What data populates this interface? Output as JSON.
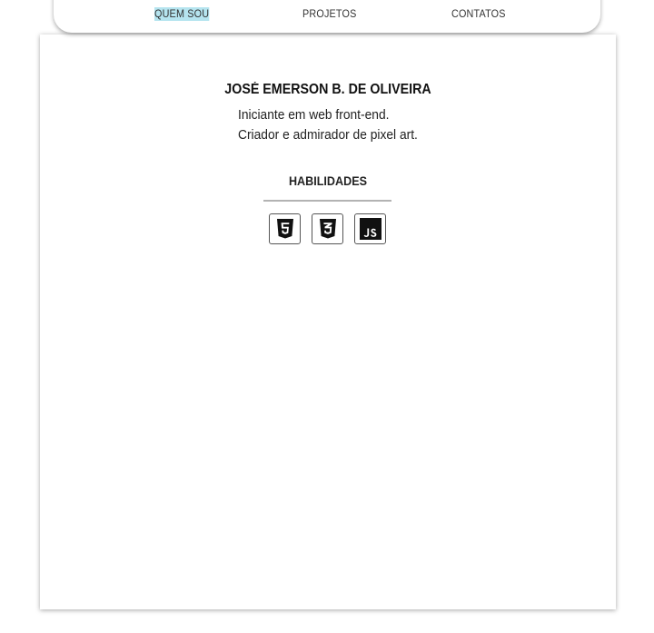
{
  "nav": {
    "items": [
      {
        "label": "QUEM SOU",
        "active": true
      },
      {
        "label": "PROJETOS",
        "active": false
      },
      {
        "label": "CONTATOS",
        "active": false
      }
    ],
    "active_highlight_color": "#b5e4ef"
  },
  "profile": {
    "name": "JOSÉ EMERSON B. DE OLIVEIRA",
    "bio_line_1": "Iniciante em web front-end.",
    "bio_line_2": "Criador e admirador de pixel art."
  },
  "skills": {
    "title": "HABILIDADES",
    "icons": [
      "html5-icon",
      "css3-icon",
      "javascript-icon"
    ]
  }
}
